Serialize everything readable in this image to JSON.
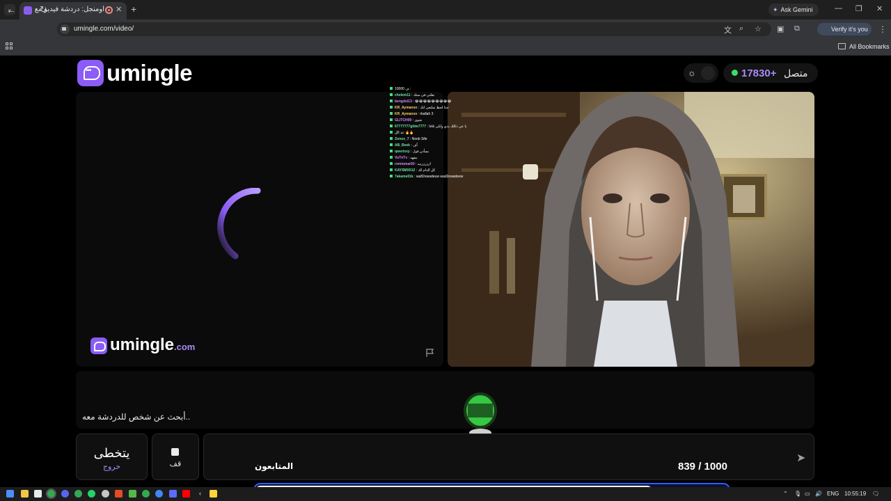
{
  "browser": {
    "tab_title": "أومنجل: دردشة فيديو مع الغرباء",
    "new_tab_label": "+",
    "gemini_label": "Ask Gemini",
    "url": "umingle.com/video/",
    "verify_label": "Verify it's you",
    "bookmarks_label": "All Bookmarks"
  },
  "header": {
    "logo_text": "umingle",
    "online_count": "17830+",
    "online_label": "متصل"
  },
  "stage": {
    "watermark_text": "umingle",
    "watermark_suffix": ".com"
  },
  "chat_overlay": [
    {
      "user": "",
      "msg": "ف 10000 :",
      "color": "g"
    },
    {
      "user": "chelem11",
      "msg": ": تقلتي في ستك",
      "color": "g"
    },
    {
      "user": "bengdsl13",
      "msg": ": 😂😂😂😂😂😂😂😂😂",
      "color": "p"
    },
    {
      "user": "KR_Aymanxo",
      "msg": ": جدا لحظ سلنعن انك",
      "color": "y"
    },
    {
      "user": "KR_Aymanxo",
      "msg": ": rkallah 3",
      "color": "y"
    },
    {
      "user": "GLITCH09",
      "msg": ": نجوى",
      "color": "p"
    },
    {
      "user": "67777777gibie7777",
      "msg": ": يا عي ذكلك بدي ولكن تلاقا",
      "color": "g"
    },
    {
      "user": "",
      "msg": "عد الل 🔥🔥",
      "color": "g"
    },
    {
      "user": "Zonos_7",
      "msg": ": Noob Sife",
      "color": "g"
    },
    {
      "user": "AB_Beek",
      "msg": ": آف",
      "color": "g"
    },
    {
      "user": "qwertxxy",
      "msg": ": بسأذن قول",
      "color": "g"
    },
    {
      "user": "VuTnTv",
      "msg": ": بيفهد",
      "color": "p"
    },
    {
      "user": "romiomar50",
      "msg": ": ازززززبيه",
      "color": "p"
    },
    {
      "user": "KAYSMX012",
      "msg": ": كل الدام لك",
      "color": "g"
    },
    {
      "user": "7akame01k",
      "msg": ": wa82ewadeuw wad2ewadeew",
      "color": "g"
    }
  ],
  "status": {
    "searching_text": "..أبحث عن شخص للدردشة معه"
  },
  "controls": {
    "skip_label": "يتخطى",
    "skip_sub": "خروج",
    "stop_label": "قف",
    "followers_label": "المتابعون",
    "followers_current": "839",
    "followers_separator": " / ",
    "followers_goal": "1000",
    "followers_progress": 0.839
  },
  "taskbar": {
    "lang": "ENG",
    "time": "10:55:19"
  },
  "colors": {
    "brand": "#8b5cf6",
    "accent_text": "#a78bfa",
    "online_dot": "#3ddc6b",
    "progress_border": "#2f5bff"
  }
}
